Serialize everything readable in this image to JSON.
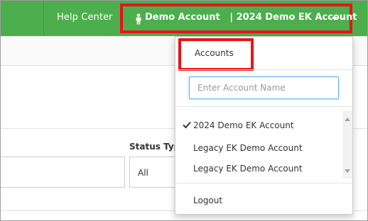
{
  "topbar": {
    "help_center": "Help Center",
    "account_toggle_label": "Demo Account   | 2024 Demo EK Account",
    "person_icon": "person-icon",
    "caret_icon": "caret-down-icon"
  },
  "background": {
    "status_label": "Status Typ",
    "status_value": "All"
  },
  "dropdown": {
    "accounts_label": "Accounts",
    "search_placeholder": "Enter Account Name",
    "search_value": "",
    "accounts": [
      {
        "name": "2024 Demo EK Account",
        "selected": true
      },
      {
        "name": "Legacy EK Demo Account",
        "selected": false
      },
      {
        "name": "Legacy EK Demo Account",
        "selected": false
      }
    ],
    "logout_label": "Logout"
  },
  "colors": {
    "nav_green": "#4cae4c",
    "highlight_red": "#e8131b",
    "focus_blue": "#66afe9"
  }
}
